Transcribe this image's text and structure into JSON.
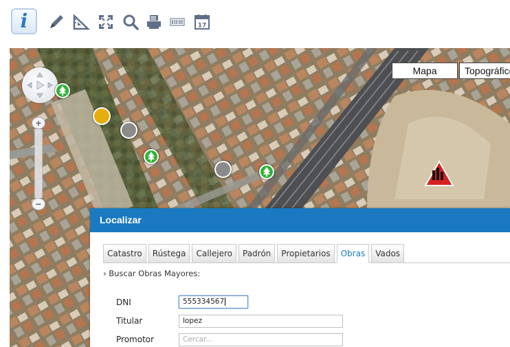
{
  "toolbar": {
    "tools": [
      {
        "name": "info",
        "icon": "info-icon",
        "glyph": "i"
      },
      {
        "name": "draw",
        "icon": "pencil-icon"
      },
      {
        "name": "measure",
        "icon": "ruler-triangle-icon"
      },
      {
        "name": "fullscreen",
        "icon": "expand-icon"
      },
      {
        "name": "search",
        "icon": "magnifier-icon"
      },
      {
        "name": "print",
        "icon": "printer-icon"
      },
      {
        "name": "barcode",
        "icon": "barcode-icon"
      },
      {
        "name": "calendar",
        "icon": "calendar-icon",
        "day": "17"
      }
    ]
  },
  "map": {
    "layers": {
      "mapa": "Mapa",
      "topo": "Topográfico"
    },
    "zoom": {
      "plus": "+",
      "minus": "−"
    }
  },
  "panel": {
    "title": "Localizar",
    "tabs": [
      "Catastro",
      "Rústega",
      "Callejero",
      "Padrón",
      "Propietarios",
      "Obras",
      "Vados"
    ],
    "active_tab": "Obras",
    "section_title": "› Buscar Obras Mayores:",
    "fields": {
      "dni": {
        "label": "DNI",
        "value": "555334567"
      },
      "titular": {
        "label": "Titular",
        "value": "lopez"
      },
      "promotor": {
        "label": "Promotor",
        "placeholder": "Cercar..."
      }
    }
  },
  "colors": {
    "accent": "#1a79c0",
    "tree_marker": "#2fb336",
    "yellow_marker": "#e5ae0c",
    "grey_marker": "#8b8b8b",
    "works_sign": "#d62020"
  }
}
